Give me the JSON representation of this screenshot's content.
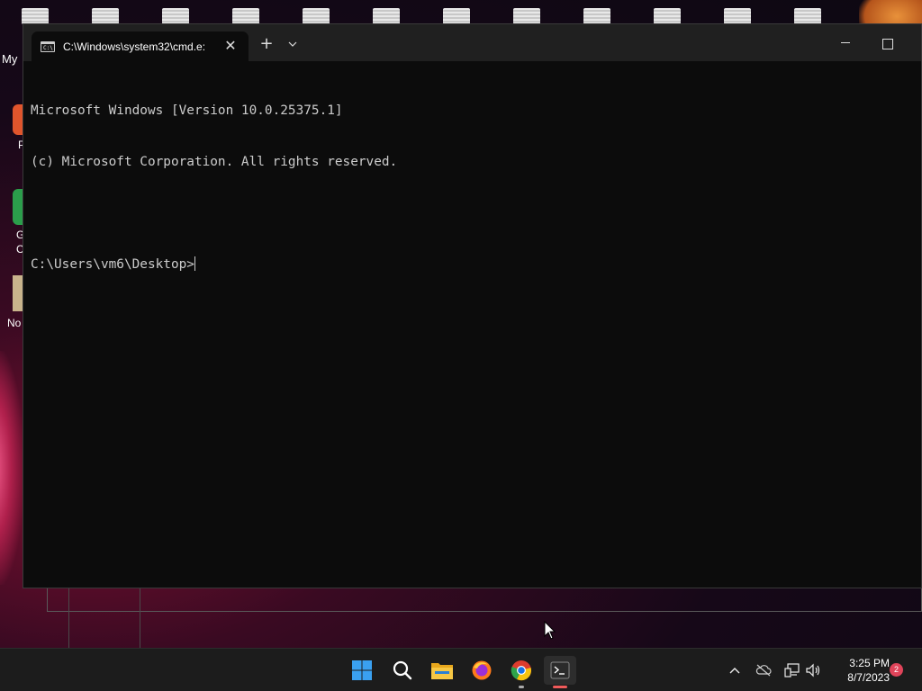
{
  "desktop": {
    "partial_label": "My",
    "left_labels": [
      "P",
      "G",
      "C",
      "No"
    ]
  },
  "window": {
    "tab_title": "C:\\Windows\\system32\\cmd.e:",
    "new_tab_symbol": "+",
    "close_symbol": "✕"
  },
  "terminal": {
    "lines": [
      "Microsoft Windows [Version 10.0.25375.1]",
      "(c) Microsoft Corporation. All rights reserved.",
      "",
      "C:\\Users\\vm6\\Desktop>"
    ]
  },
  "taskbar": {
    "icons": [
      "windows-start-icon",
      "search-icon",
      "file-explorer-icon",
      "firefox-icon",
      "chrome-icon",
      "terminal-icon"
    ],
    "clock_time": "3:25 PM",
    "clock_date": "8/7/2023",
    "notification_count": "2"
  },
  "colors": {
    "terminal_bg": "#0c0c0c",
    "titlebar_bg": "#202020",
    "taskbar_bg": "#1c1c1c",
    "accent_indicator": "#f05a5a"
  }
}
